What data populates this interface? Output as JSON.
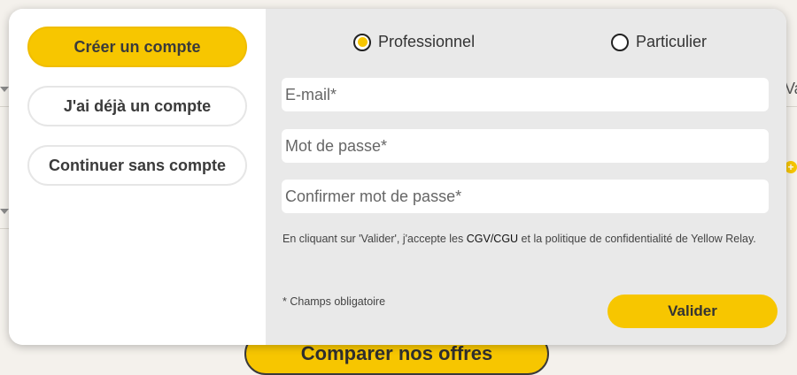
{
  "background": {
    "compare_button_label": "Comparer nos offres",
    "partial_text": "Va",
    "plus_icon": "+"
  },
  "account_options": {
    "create": "Créer un compte",
    "existing": "J'ai déjà un compte",
    "guest": "Continuer sans compte"
  },
  "account_type": {
    "selected": "Professionnel",
    "options": [
      "Professionnel",
      "Particulier"
    ]
  },
  "form": {
    "email_placeholder": "E-mail*",
    "password_placeholder": "Mot de passe*",
    "confirm_placeholder": "Confirmer mot de passe*",
    "legal_prefix": "En cliquant sur 'Valider', j'accepte les ",
    "legal_link": "CGV/CGU",
    "legal_suffix": " et la politique de confidentialité de Yellow Relay.",
    "required_note": "* Champs obligatoire",
    "submit_label": "Valider"
  },
  "colors": {
    "accent": "#f7c600",
    "panel": "#e9e9e9"
  }
}
